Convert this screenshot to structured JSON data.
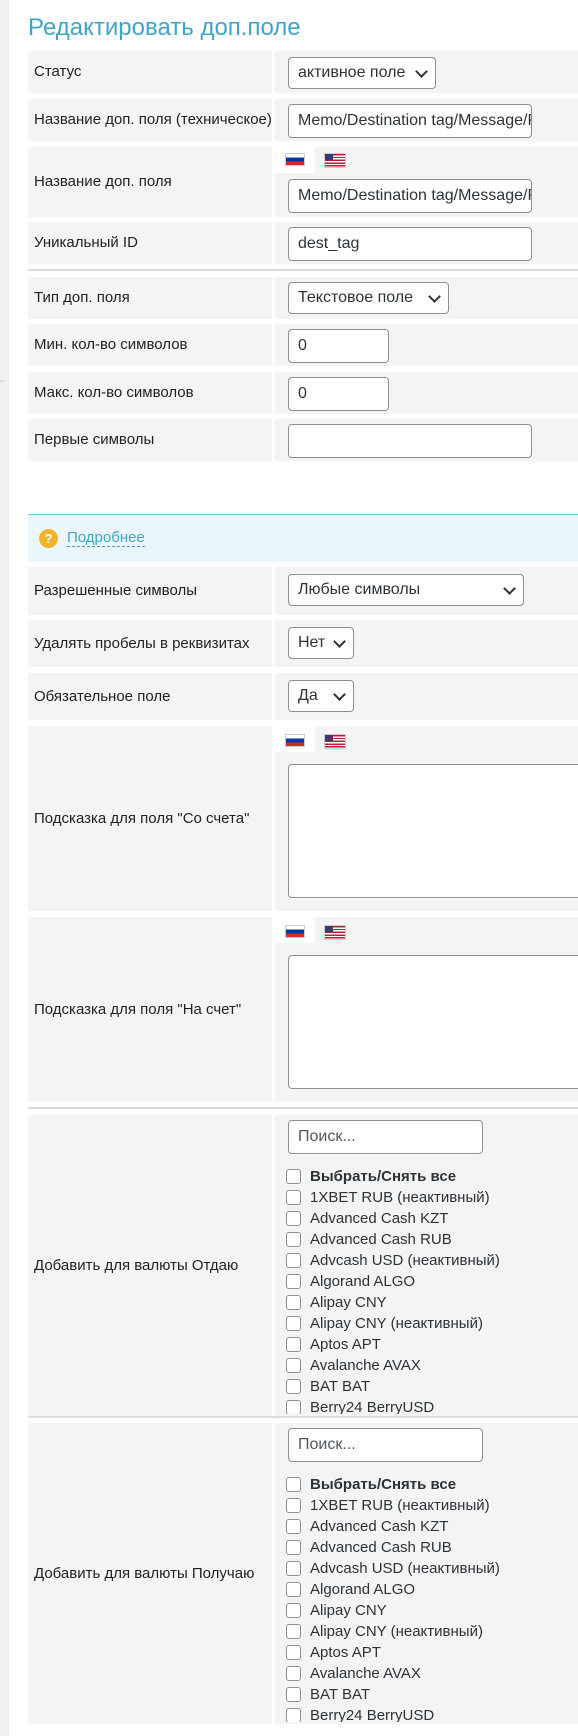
{
  "page_title": "Редактировать доп.поле",
  "status": {
    "label": "Статус",
    "value": "активное поле"
  },
  "tech_name": {
    "label": "Название доп. поля (техническое)",
    "value": "Memo/Destination tag/Message/Payment"
  },
  "field_name": {
    "label": "Название доп. поля",
    "value": "Memo/Destination tag/Message/Payment"
  },
  "unique_id": {
    "label": "Уникальный ID",
    "value": "dest_tag"
  },
  "field_type": {
    "label": "Тип доп. поля",
    "value": "Текстовое поле"
  },
  "min_chars": {
    "label": "Мин. кол-во символов",
    "value": "0"
  },
  "max_chars": {
    "label": "Макс. кол-во символов",
    "value": "0"
  },
  "first_chars": {
    "label": "Первые символы",
    "value": ""
  },
  "notice": {
    "link": "Подробнее",
    "icon": "question-icon"
  },
  "allowed_chars": {
    "label": "Разрешенные символы",
    "value": "Любые символы"
  },
  "strip_spaces": {
    "label": "Удалять пробелы в реквизитах",
    "value": "Нет"
  },
  "required": {
    "label": "Обязательное поле",
    "value": "Да"
  },
  "hint_from": {
    "label": "Подсказка для поля \"Со счета\""
  },
  "hint_to": {
    "label": "Подсказка для поля \"На счет\""
  },
  "give_currencies": {
    "label": "Добавить для валюты Отдаю",
    "search_placeholder": "Поиск...",
    "select_all": "Выбрать/Снять все",
    "items": [
      "1XBET RUB (неактивный)",
      "Advanced Cash KZT",
      "Advanced Cash RUB",
      "Advcash USD (неактивный)",
      "Algorand ALGO",
      "Alipay CNY",
      "Alipay CNY (неактивный)",
      "Aptos APT",
      "Avalanche AVAX",
      "BAT BAT",
      "Berry24 BerryUSD"
    ]
  },
  "get_currencies": {
    "label": "Добавить для валюты Получаю",
    "search_placeholder": "Поиск...",
    "select_all": "Выбрать/Снять все",
    "items": [
      "1XBET RUB (неактивный)",
      "Advanced Cash KZT",
      "Advanced Cash RUB",
      "Advcash USD (неактивный)",
      "Algorand ALGO",
      "Alipay CNY",
      "Alipay CNY (неактивный)",
      "Aptos APT",
      "Avalanche AVAX",
      "BAT BAT",
      "Berry24 BerryUSD"
    ]
  },
  "colors": {
    "accent": "#3ea5c9",
    "label_bg": "#f4f4f4"
  }
}
